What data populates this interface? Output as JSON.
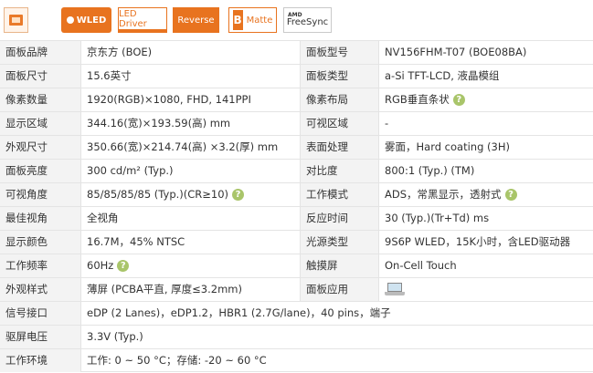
{
  "badges": {
    "wled": "WLED",
    "led_driver": "LED Driver",
    "reverse": "Reverse",
    "matte_icon": "B",
    "matte": "Matte",
    "amd": "AMD",
    "freesync": "FreeSync"
  },
  "rows": [
    {
      "l1": "面板品牌",
      "v1": "京东方 (BOE)",
      "l2": "面板型号",
      "v2": "NV156FHM-T07 (BOE08BA)"
    },
    {
      "l1": "面板尺寸",
      "v1": "15.6英寸",
      "l2": "面板类型",
      "v2": "a-Si TFT-LCD, 液晶模组"
    },
    {
      "l1": "像素数量",
      "v1": "1920(RGB)×1080, FHD, 141PPI",
      "l2": "像素布局",
      "v2": "RGB垂直条状"
    },
    {
      "l1": "显示区域",
      "v1": "344.16(宽)×193.59(高) mm",
      "l2": "可视区域",
      "v2": "-"
    },
    {
      "l1": "外观尺寸",
      "v1": "350.66(宽)×214.74(高) ×3.2(厚) mm",
      "l2": "表面处理",
      "v2": "雾面，Hard coating (3H)"
    },
    {
      "l1": "面板亮度",
      "v1": "300 cd/m² (Typ.)",
      "l2": "对比度",
      "v2": "800:1 (Typ.) (TM)"
    },
    {
      "l1": "可视角度",
      "v1": "85/85/85/85 (Typ.)(CR≥10)",
      "l2": "工作模式",
      "v2": "ADS，常黑显示，透射式"
    },
    {
      "l1": "最佳视角",
      "v1": "全视角",
      "l2": "反应时间",
      "v2": "30 (Typ.)(Tr+Td) ms"
    },
    {
      "l1": "显示颜色",
      "v1": "16.7M，45% NTSC",
      "l2": "光源类型",
      "v2": "9S6P WLED，15K小时，含LED驱动器"
    },
    {
      "l1": "工作频率",
      "v1": "60Hz",
      "l2": "触摸屏",
      "v2": "On-Cell Touch"
    },
    {
      "l1": "外观样式",
      "v1": "薄屏 (PCBA平直, 厚度≤3.2mm)",
      "l2": "面板应用",
      "v2": ""
    },
    {
      "l1": "信号接口",
      "v1": "eDP (2 Lanes)，eDP1.2，HBR1 (2.7G/lane)，40 pins，端子"
    },
    {
      "l1": "驱屏电压",
      "v1": "3.3V (Typ.)"
    },
    {
      "l1": "工作环境",
      "v1": "工作: 0 ~ 50 °C；存储: -20 ~ 60 °C"
    }
  ],
  "help_icon": "?",
  "colors": {
    "accent": "#e8731f",
    "help": "#a9c56a",
    "label_bg": "#f3f3f3"
  }
}
